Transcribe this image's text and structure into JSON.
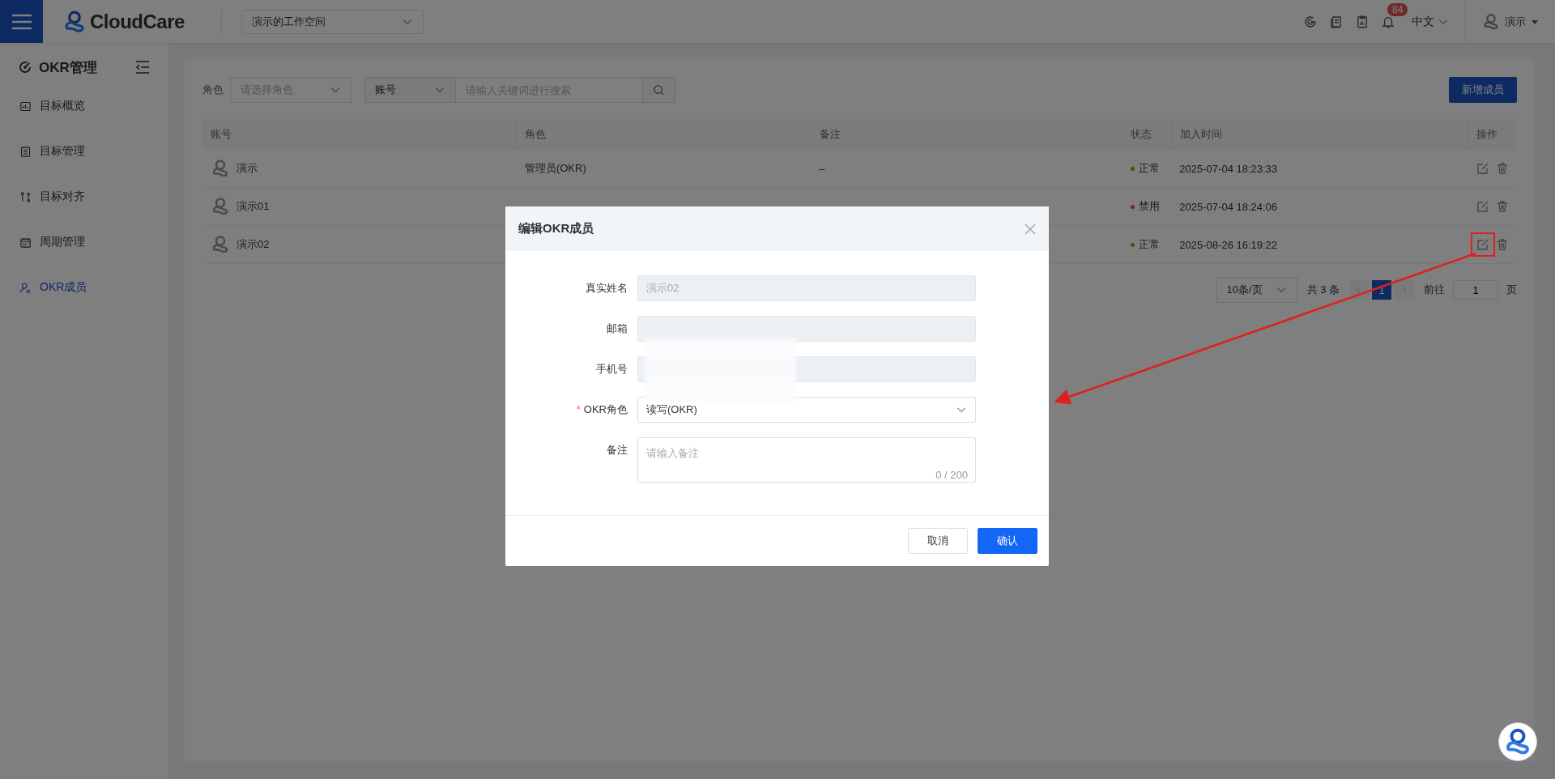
{
  "topbar": {
    "brand": "CloudCare",
    "workspace": "演示的工作空间",
    "notification_count": "84",
    "language": "中文",
    "user": "演示"
  },
  "sidebar": {
    "title": "OKR管理",
    "items": [
      {
        "label": "目标概览",
        "selected": false
      },
      {
        "label": "目标管理",
        "selected": false
      },
      {
        "label": "目标对齐",
        "selected": false
      },
      {
        "label": "周期管理",
        "selected": false
      },
      {
        "label": "OKR成员",
        "selected": true
      }
    ]
  },
  "toolbar": {
    "role_label": "角色",
    "role_placeholder": "请选择角色",
    "search_type": "账号",
    "search_placeholder": "请输入关键词进行搜索",
    "add_button": "新增成员"
  },
  "table": {
    "columns": [
      "账号",
      "角色",
      "备注",
      "状态",
      "加入时间",
      "操作"
    ],
    "rows": [
      {
        "account": "演示",
        "role": "管理员(OKR)",
        "remark": "–",
        "status": "正常",
        "color": "#29620d",
        "joined": "2025-07-04 18:23:33",
        "highlighted": false
      },
      {
        "account": "演示01",
        "status": "禁用",
        "color": "#742a1d",
        "joined": "2025-07-04 18:24:06",
        "highlighted": false
      },
      {
        "account": "演示02",
        "status": "正常",
        "color": "#29620d",
        "joined": "2025-08-26 16:19:22",
        "highlighted": true
      }
    ]
  },
  "pagination": {
    "page_size": "10条/页",
    "total": "共 3 条",
    "pages": [
      {
        "label": "1",
        "selected": true
      }
    ],
    "goto_label": "前往",
    "goto_value": "1",
    "page_suffix": "页"
  },
  "dialog": {
    "title": "编辑OKR成员",
    "required_mark": "*",
    "fields": [
      {
        "kind": "input",
        "label": "真实姓名",
        "value": "演示02",
        "disabled": true,
        "required": false
      },
      {
        "kind": "input",
        "label": "邮箱",
        "disabled": true,
        "required": false
      },
      {
        "kind": "input",
        "label": "手机号",
        "disabled": true,
        "required": false
      },
      {
        "kind": "select",
        "label": "OKR角色",
        "value": "读写(OKR)",
        "disabled": false,
        "required": true
      },
      {
        "kind": "textarea",
        "label": "备注",
        "placeholder": "请输入备注",
        "counter": "0 / 200",
        "disabled": false,
        "required": false
      }
    ],
    "buttons": [
      {
        "label": "取消",
        "kind": "default"
      },
      {
        "label": "确认",
        "kind": "primary"
      }
    ]
  }
}
